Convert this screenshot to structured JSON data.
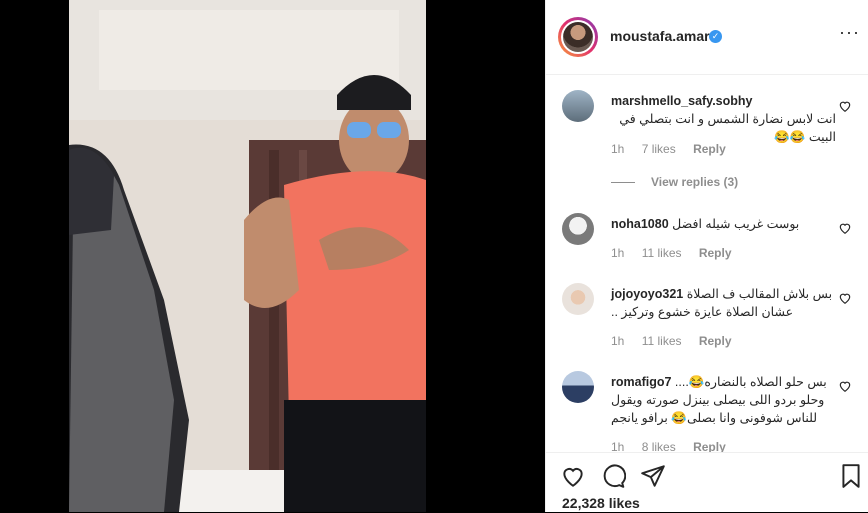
{
  "post": {
    "username": "moustafa.amar",
    "verified_mark": "✓",
    "more_label": "···",
    "likes": "22,328 likes"
  },
  "comments": [
    {
      "user": "marshmello_safy.sobhy",
      "text": "انت لابس نضارة الشمس و انت بتصلي في البيت 😂😂",
      "time": "1h",
      "likes": "7 likes",
      "reply": "Reply",
      "view_replies": "View replies (3)"
    },
    {
      "user": "noha1080",
      "text": "بوست غريب شيله افضل",
      "time": "1h",
      "likes": "11 likes",
      "reply": "Reply"
    },
    {
      "user": "jojoyoyo321",
      "text": "بس بلاش المقالب ف الصلاة عشان الصلاة عايزة خشوع وتركيز ..",
      "time": "1h",
      "likes": "11 likes",
      "reply": "Reply"
    },
    {
      "user": "romafigo7",
      "text": "بس حلو الصلاه بالنضاره😂.... وحلو بردو اللى بيصلى بينزل صورته ويقول للناس شوفونى وانا بصلى😂 برافو يانجم",
      "time": "1h",
      "likes": "8 likes",
      "reply": "Reply"
    }
  ],
  "icons": {
    "like": "heart-icon",
    "comment": "comment-icon",
    "share": "share-icon",
    "save": "bookmark-icon"
  },
  "colors": {
    "verified": "#3897f0",
    "meta_text": "#8e8e8e",
    "text": "#262626"
  }
}
